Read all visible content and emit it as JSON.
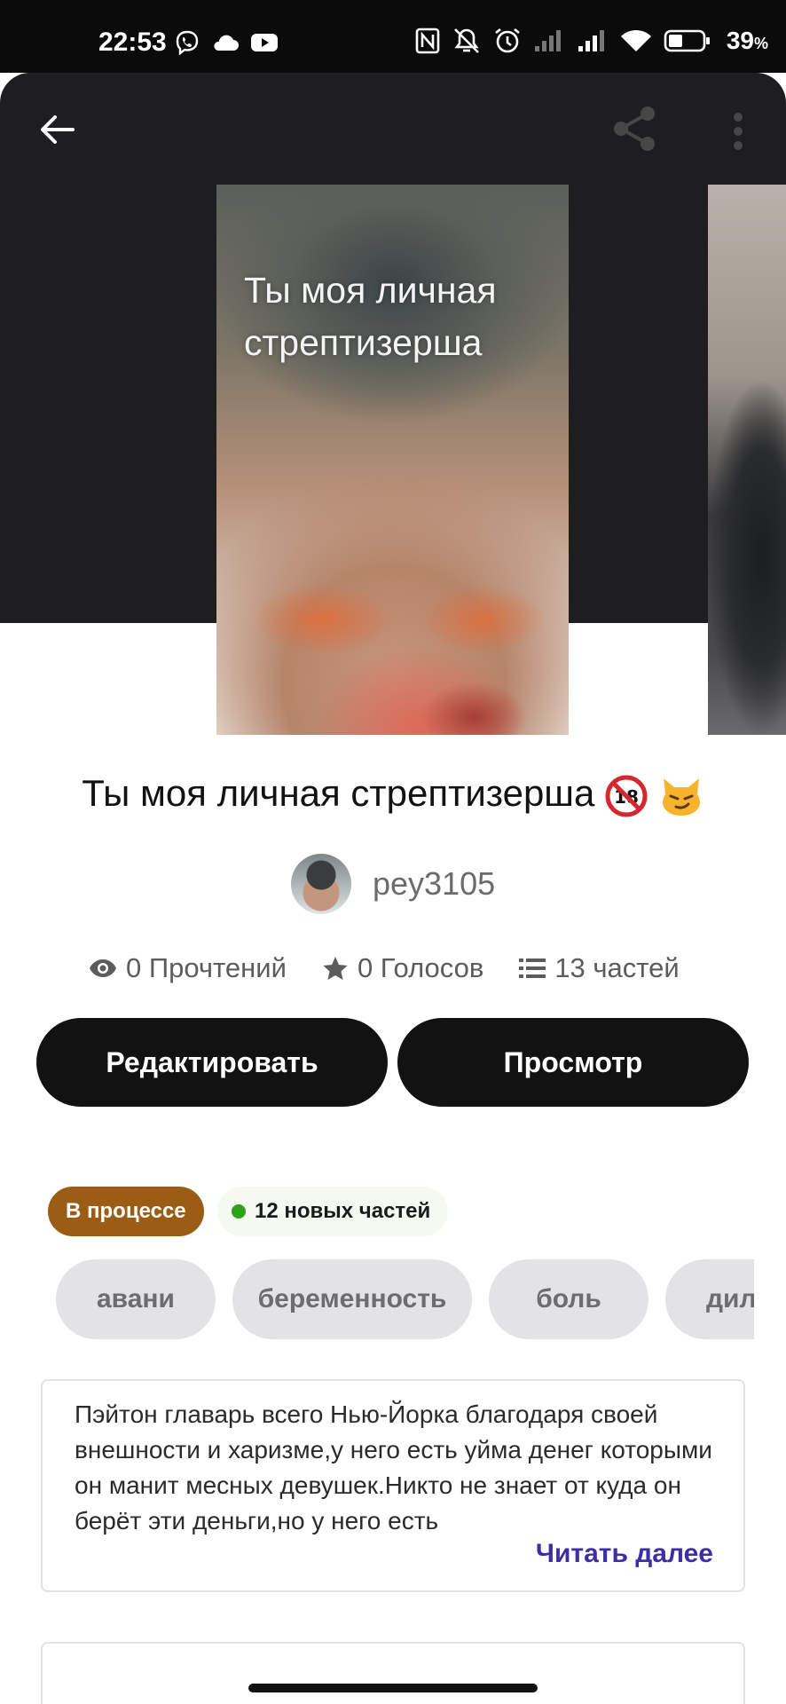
{
  "status_bar": {
    "time": "22:53",
    "battery_percent": "39",
    "battery_unit": "%",
    "left_icons": [
      "viber-icon",
      "cloud-icon",
      "youtube-icon"
    ],
    "right_icons": [
      "nfc-icon",
      "mute-icon",
      "alarm-icon",
      "signal-weak-icon",
      "signal-icon",
      "wifi-icon",
      "battery-icon"
    ]
  },
  "header": {
    "back_icon": "arrow-left-icon",
    "share_icon": "share-icon",
    "more_icon": "more-vertical-icon"
  },
  "cover": {
    "text": "Ты моя личная стрептизерша"
  },
  "story": {
    "title": "Ты моя личная стрептизерша",
    "title_emoji": [
      "🔞",
      "😼"
    ]
  },
  "author": {
    "name": "pey3105"
  },
  "stats": {
    "reads": "0 Прочтений",
    "votes": "0 Голосов",
    "parts": "13 частей"
  },
  "actions": {
    "edit_label": "Редактировать",
    "preview_label": "Просмотр"
  },
  "badges": {
    "status": "В процессе",
    "new_parts": "12 новых частей"
  },
  "tags": [
    "авани",
    "беременность",
    "боль",
    "дил"
  ],
  "description": {
    "text": "Пэйтон главарь всего Нью-Йорка благодаря своей внешности и харизме,у него есть уйма денег которыми он манит месных девушек.Никто не знает от куда он берёт эти деньги,но у него есть",
    "read_more": "Читать далее"
  },
  "colors": {
    "header_bg": "#1e1e20",
    "button_bg": "#121212",
    "status_badge": "#9b5d14",
    "new_parts_dot": "#2fa01a",
    "read_more": "#3c2fa6",
    "tag_bg": "#e3e3e6"
  }
}
